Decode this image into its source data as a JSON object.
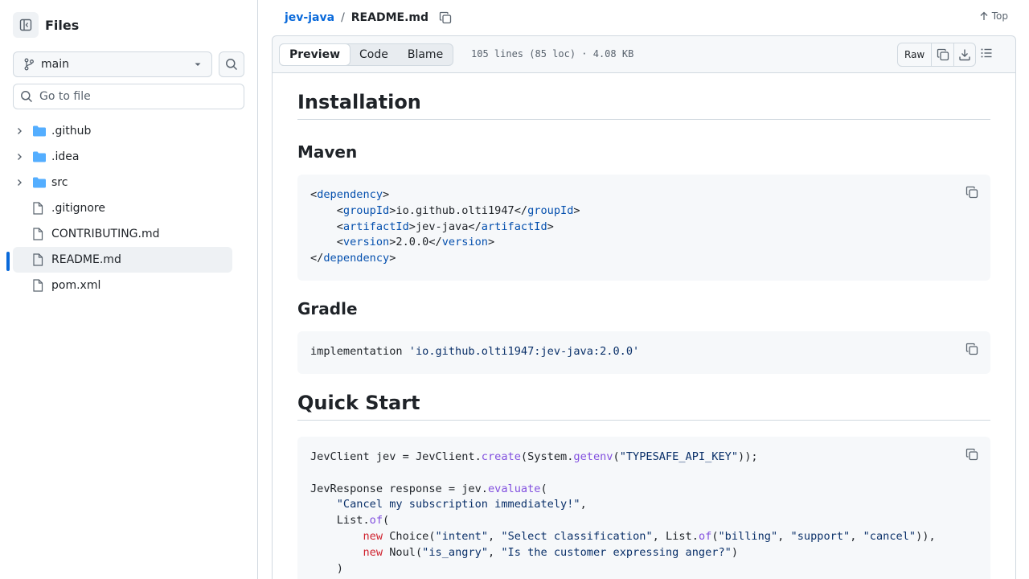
{
  "sidebar": {
    "title": "Files",
    "branch": "main",
    "goto_placeholder": "Go to file",
    "items": [
      {
        "label": ".github",
        "type": "folder"
      },
      {
        "label": ".idea",
        "type": "folder"
      },
      {
        "label": "src",
        "type": "folder"
      },
      {
        "label": ".gitignore",
        "type": "file"
      },
      {
        "label": "CONTRIBUTING.md",
        "type": "file"
      },
      {
        "label": "README.md",
        "type": "file",
        "selected": true
      },
      {
        "label": "pom.xml",
        "type": "file"
      }
    ]
  },
  "breadcrumb": {
    "repo": "jev-java",
    "separator": "/",
    "file": "README.md",
    "top_label": "Top"
  },
  "file_header": {
    "tabs": [
      "Preview",
      "Code",
      "Blame"
    ],
    "active_tab": "Preview",
    "meta": "105 lines (85 loc) · 4.08 KB",
    "raw_label": "Raw"
  },
  "readme": {
    "h_installation": "Installation",
    "h_maven": "Maven",
    "maven_lines": [
      [
        "<",
        "dependency",
        ">"
      ],
      [
        "    <",
        "groupId",
        ">io.github.olti1947</",
        "groupId",
        ">"
      ],
      [
        "    <",
        "artifactId",
        ">jev-java</",
        "artifactId",
        ">"
      ],
      [
        "    <",
        "version",
        ">2.0.0</",
        "version",
        ">"
      ],
      [
        "</",
        "dependency",
        ">"
      ]
    ],
    "h_gradle": "Gradle",
    "gradle_plain": "implementation ",
    "gradle_str": "'io.github.olti1947:jev-java:2.0.0'",
    "h_quickstart": "Quick Start",
    "qs": {
      "l1a": "JevClient jev = JevClient.",
      "l1fn": "create",
      "l1b": "(System.",
      "l1fn2": "getenv",
      "l1c": "(",
      "l1str": "\"TYPESAFE_API_KEY\"",
      "l1d": "));",
      "l3a": "JevResponse response = jev.",
      "l3fn": "evaluate",
      "l3b": "(",
      "l4str": "\"Cancel my subscription immediately!\"",
      "l4b": ",",
      "l5a": "List.",
      "l5fn": "of",
      "l5b": "(",
      "l6kw": "new",
      "l6a": " Choice(",
      "l6s1": "\"intent\"",
      "l6s2": "\"Select classification\"",
      "l6b": ", List.",
      "l6fn": "of",
      "l6s3": "\"billing\"",
      "l6s4": "\"support\"",
      "l6s5": "\"cancel\"",
      "l6c": ")),",
      "l7kw": "new",
      "l7a": " Noul(",
      "l7s1": "\"is_angry\"",
      "l7s2": "\"Is the customer expressing anger?\"",
      "l7b": ")",
      "l8": ")",
      "comma": ", ",
      "open": "(",
      "close": ")"
    }
  },
  "colors": {
    "accent": "#0969da",
    "tag": "#0550ae",
    "string": "#0a3069",
    "function": "#8250df",
    "keyword": "#cf222e"
  }
}
